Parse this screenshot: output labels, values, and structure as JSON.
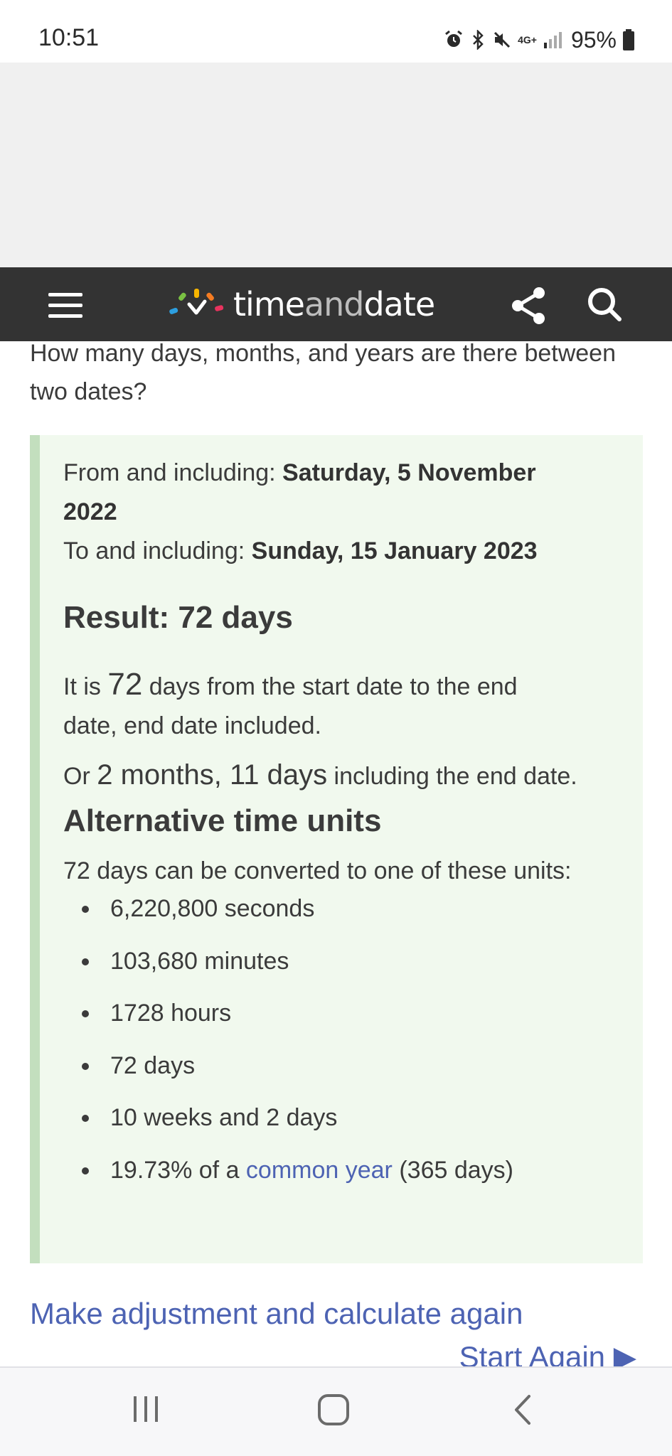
{
  "status_bar": {
    "time": "10:51",
    "network": "4G+",
    "battery": "95%",
    "icons": [
      "alarm-icon",
      "bluetooth-icon",
      "mute-icon",
      "signal-icon",
      "battery-icon"
    ]
  },
  "header": {
    "logo": {
      "part1": "time",
      "part2": "and",
      "part3": "date"
    },
    "icons": [
      "menu-icon",
      "share-icon",
      "search-icon"
    ]
  },
  "content": {
    "intro": "How many days, months, and years are there between two dates?",
    "from_label": "From and including: ",
    "from_value_line1": "Saturday, 5 November",
    "from_value_line2": "2022",
    "to_label": "To and including: ",
    "to_value": "Sunday, 15 January 2023",
    "result_title": "Result: 72 days",
    "desc_prefix": "It is ",
    "desc_number": "72",
    "desc_suffix_line1": " days from the start date to the end",
    "desc_line2": "date, end date included.",
    "or_prefix": "Or ",
    "or_big": "2 months, 11 days",
    "or_suffix": " including the end date.",
    "alt_title": "Alternative time units",
    "alt_intro": "72 days can be converted to one of these units:",
    "units": [
      "6,220,800 seconds",
      "103,680 minutes",
      "1728 hours",
      "72 days",
      "10 weeks and 2 days"
    ],
    "year_unit": {
      "prefix": "19.73% of a ",
      "link": "common year",
      "suffix": " (365 days)"
    },
    "adjust_link": "Make adjustment and calculate again",
    "start_again": "Start Again ▶"
  },
  "colors": {
    "header_bg": "#333333",
    "result_bg": "#f1f9ee",
    "result_border": "#c3dfbe",
    "link": "#4d63b3"
  },
  "nav_bar": {
    "icons": [
      "recent-apps-icon",
      "home-icon",
      "back-icon"
    ]
  }
}
